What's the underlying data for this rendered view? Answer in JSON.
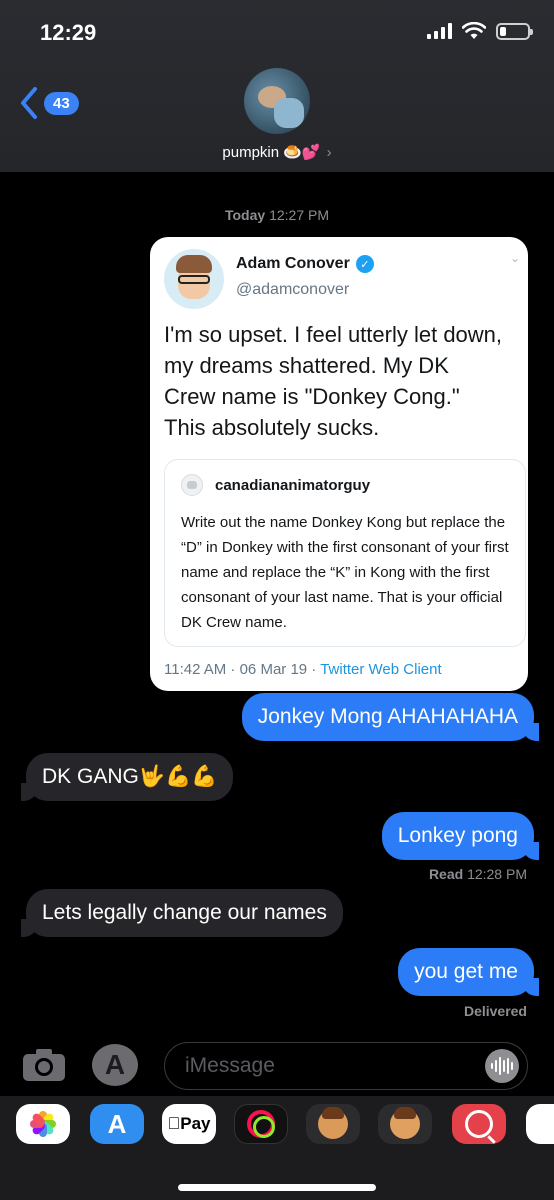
{
  "status_bar": {
    "time": "12:29"
  },
  "header": {
    "back_count": "43",
    "contact_name": "pumpkin 🍮💕",
    "chevron": "›"
  },
  "thread": {
    "timestamp_day": "Today",
    "timestamp_time": "12:27 PM",
    "tweet": {
      "author_name": "Adam Conover",
      "author_handle": "@adamconover",
      "verified_mark": "✓",
      "caret": "⌄",
      "text": "I'm so upset. I feel utterly let down, my dreams shattered. My DK Crew name is \"Donkey Cong.\" This absolutely sucks.",
      "quote_author": "canadiananimatorguy",
      "quote_text": "Write out the name Donkey Kong but replace the “D” in Donkey with the first consonant of your first name and replace the “K” in Kong with the first consonant of your last name. That is your official DK Crew name.",
      "meta_time": "11:42 AM · 06 Mar 19 · ",
      "meta_client": "Twitter Web Client"
    },
    "messages": [
      {
        "from": "me",
        "text": "Jonkey Mong AHAHAHAHA"
      },
      {
        "from": "them",
        "text": "DK GANG🤟💪💪"
      },
      {
        "from": "me",
        "text": "Lonkey pong"
      },
      {
        "from": "them",
        "text": "Lets legally change our names"
      },
      {
        "from": "me",
        "text": "you get me"
      }
    ],
    "read_label": "Read",
    "read_time": "12:28 PM",
    "delivered_label": "Delivered"
  },
  "composer": {
    "placeholder": "iMessage",
    "apps_glyph": "A"
  },
  "app_drawer": {
    "apps": [
      "photos-icon",
      "app-store-icon",
      "apple-pay-icon",
      "activity-icon",
      "memoji-icon",
      "memoji-stickers-icon",
      "images-search-icon",
      "more-app-icon"
    ],
    "apple_pay_label": "Pay"
  },
  "colors": {
    "sent_bubble": "#2b7cf6",
    "received_bubble": "#26262a",
    "accent": "#3b82f6"
  }
}
